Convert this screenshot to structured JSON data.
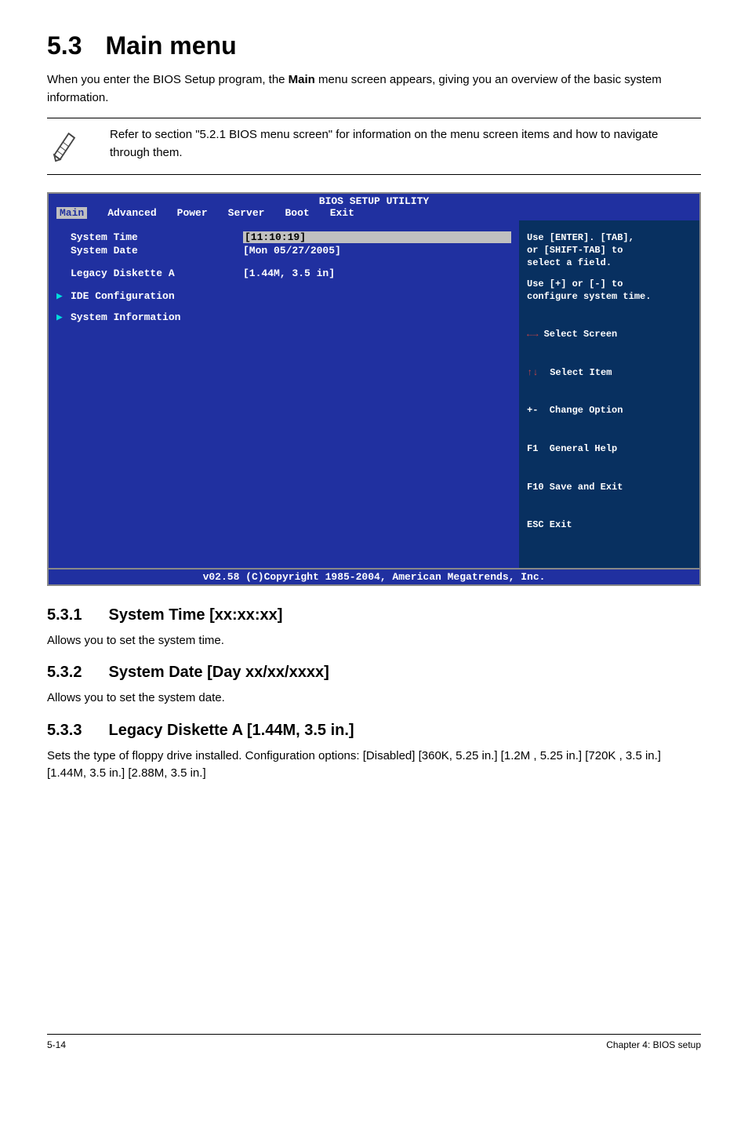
{
  "heading": {
    "num": "5.3",
    "title": "Main menu"
  },
  "intro_part1": "When you enter the BIOS Setup program, the ",
  "intro_bold": "Main",
  "intro_part2": " menu screen appears, giving you an overview of the basic system information.",
  "note": "Refer to section \"5.2.1 BIOS menu screen\" for information on the menu screen items and how to navigate through them.",
  "bios": {
    "title": "BIOS SETUP UTILITY",
    "tabs": [
      "Main",
      "Advanced",
      "Power",
      "Server",
      "Boot",
      "Exit"
    ],
    "rows": [
      {
        "label": "System Time",
        "value": "[11:10:19]",
        "highlight": true
      },
      {
        "label": "System Date",
        "value": "[Mon 05/27/2005]"
      }
    ],
    "legacy_label": "Legacy Diskette A",
    "legacy_value": "[1.44M, 3.5 in]",
    "sub_items": [
      "IDE Configuration",
      "System Information"
    ],
    "help": {
      "line1": "Use [ENTER]. [TAB],",
      "line2": "or [SHIFT-TAB] to",
      "line3": "select a field.",
      "line4": "Use [+] or [-] to",
      "line5": "configure system time."
    },
    "keys": {
      "select_screen": " Select Screen",
      "select_item": "    Select Item",
      "change_option": "+-  Change Option",
      "general_help": "F1  General Help",
      "save_exit": "F10 Save and Exit",
      "esc_exit": "ESC Exit"
    },
    "footer": "v02.58 (C)Copyright 1985-2004, American Megatrends, Inc."
  },
  "sub1": {
    "num": "5.3.1",
    "title": "System Time [xx:xx:xx]",
    "body": "Allows you to set the system time."
  },
  "sub2": {
    "num": "5.3.2",
    "title": "System Date [Day xx/xx/xxxx]",
    "body": "Allows you to set the system date."
  },
  "sub3": {
    "num": "5.3.3",
    "title": "Legacy Diskette A [1.44M, 3.5 in.]",
    "body": "Sets the type of floppy drive installed. Configuration options: [Disabled] [360K, 5.25 in.] [1.2M , 5.25 in.] [720K , 3.5 in.] [1.44M, 3.5 in.] [2.88M, 3.5 in.]"
  },
  "footer": {
    "left": "5-14",
    "right": "Chapter 4: BIOS setup"
  }
}
